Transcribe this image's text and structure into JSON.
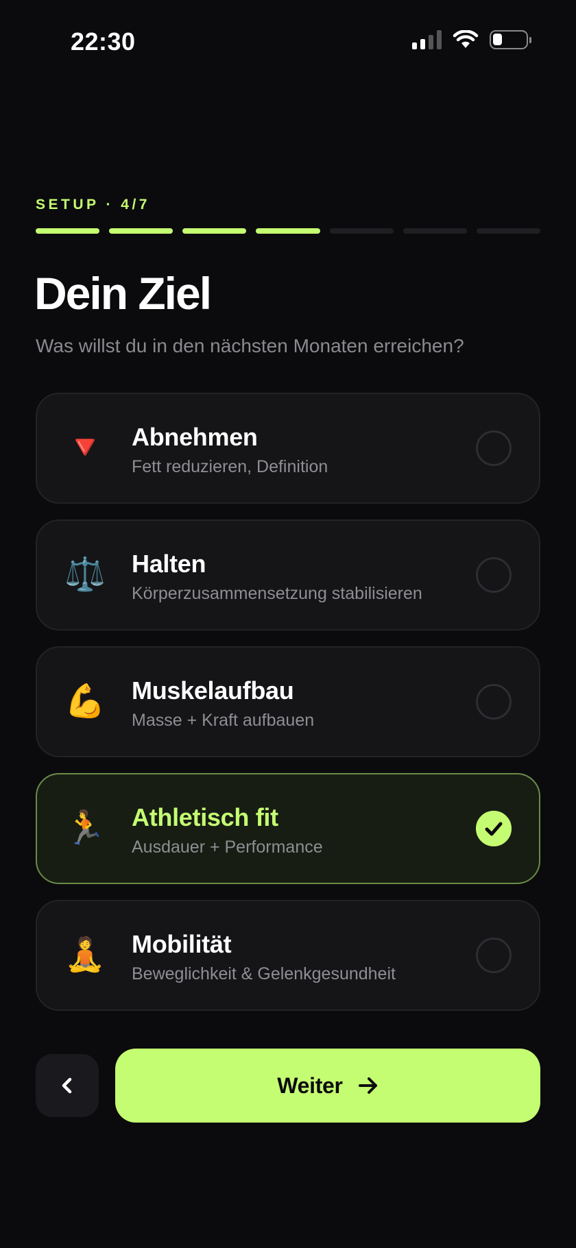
{
  "status_bar": {
    "time": "22:30",
    "icons": [
      "signal-icon",
      "wifi-icon",
      "battery-icon"
    ]
  },
  "header": {
    "step_label": "SETUP · 4/7",
    "progress": {
      "current": 4,
      "total": 7
    },
    "title": "Dein Ziel",
    "subtitle": "Was willst du in den nächsten Monaten erreichen?"
  },
  "options": [
    {
      "icon": "🔻",
      "icon_name": "red-triangle-down-icon",
      "title": "Abnehmen",
      "subtitle": "Fett reduzieren, Definition",
      "selected": false
    },
    {
      "icon": "⚖️",
      "icon_name": "balance-scale-icon",
      "title": "Halten",
      "subtitle": "Körperzusammensetzung stabilisieren",
      "selected": false
    },
    {
      "icon": "💪",
      "icon_name": "flexed-biceps-icon",
      "title": "Muskelaufbau",
      "subtitle": "Masse + Kraft aufbauen",
      "selected": false
    },
    {
      "icon": "🏃",
      "icon_name": "runner-icon",
      "title": "Athletisch fit",
      "subtitle": "Ausdauer + Performance",
      "selected": true
    },
    {
      "icon": "🧘",
      "icon_name": "lotus-position-icon",
      "title": "Mobilität",
      "subtitle": "Beweglichkeit & Gelenkgesundheit",
      "selected": false
    }
  ],
  "footer": {
    "back_icon": "chevron-left-icon",
    "next_label": "Weiter",
    "next_icon": "arrow-right-icon"
  },
  "colors": {
    "accent": "#c5fd72",
    "background": "#0b0b0d",
    "card": "#151518",
    "card_selected": "#171d13"
  }
}
